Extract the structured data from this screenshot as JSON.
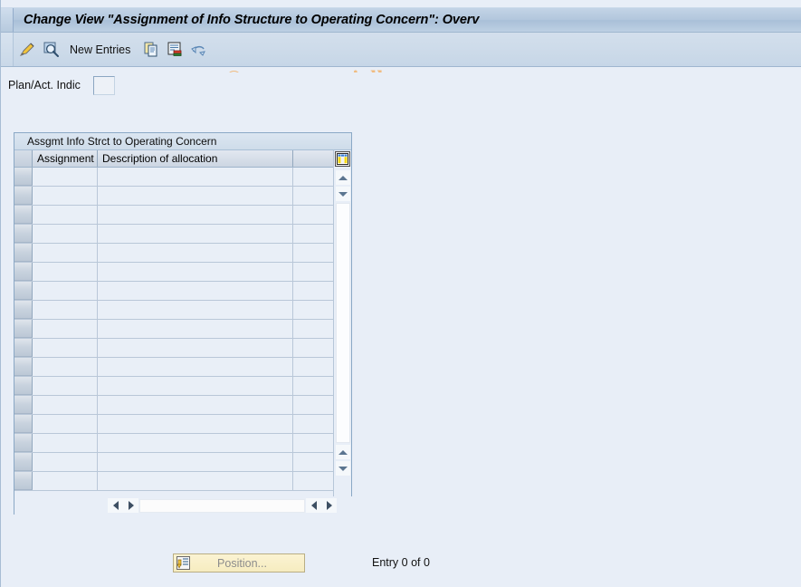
{
  "window": {
    "title": "Change View \"Assignment of Info Structure to Operating Concern\": Overv"
  },
  "toolbar": {
    "icons": [
      {
        "name": "display-change-icon",
        "glyph": "✎"
      },
      {
        "name": "check-entries-icon",
        "glyph": "🔍"
      }
    ],
    "new_entries_label": "New Entries",
    "trailing_icons": [
      {
        "name": "copy-as-icon"
      },
      {
        "name": "delete-icon"
      },
      {
        "name": "undo-icon"
      }
    ]
  },
  "watermark": {
    "text": "© www.tutorialkart.com",
    "color": "#f0bc82"
  },
  "form": {
    "plan_act_label": "Plan/Act. Indic",
    "plan_act_value": "",
    "plan_act_placeholder": ""
  },
  "table": {
    "caption": "Assgmt Info Strct to Operating Concern",
    "columns": [
      "Assignment",
      "Description of allocation"
    ],
    "rows": [
      {
        "assignment": "",
        "description": ""
      },
      {
        "assignment": "",
        "description": ""
      },
      {
        "assignment": "",
        "description": ""
      },
      {
        "assignment": "",
        "description": ""
      },
      {
        "assignment": "",
        "description": ""
      },
      {
        "assignment": "",
        "description": ""
      },
      {
        "assignment": "",
        "description": ""
      },
      {
        "assignment": "",
        "description": ""
      },
      {
        "assignment": "",
        "description": ""
      },
      {
        "assignment": "",
        "description": ""
      },
      {
        "assignment": "",
        "description": ""
      },
      {
        "assignment": "",
        "description": ""
      },
      {
        "assignment": "",
        "description": ""
      },
      {
        "assignment": "",
        "description": ""
      },
      {
        "assignment": "",
        "description": ""
      },
      {
        "assignment": "",
        "description": ""
      },
      {
        "assignment": "",
        "description": ""
      }
    ],
    "config_icon": "table-settings-icon",
    "scroll_up_icon": "scroll-up-icon",
    "scroll_down_icon": "scroll-down-icon",
    "scroll_left_icon": "scroll-left-icon",
    "scroll_right_icon": "scroll-right-icon"
  },
  "footer": {
    "position_button_label": "Position...",
    "entry_status": "Entry 0 of 0"
  },
  "colors": {
    "page_background": "#e8eef7",
    "title_bar": "#b3c7dd",
    "toolbar": "#ccdae9",
    "grid_row": "#e9eff7",
    "accent_border": "#8aa8c6"
  }
}
